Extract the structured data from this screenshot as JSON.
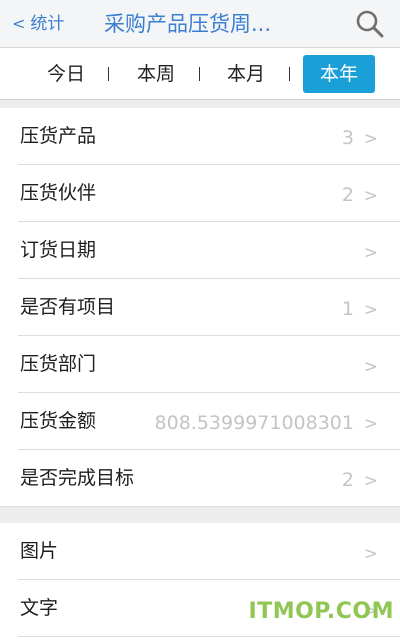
{
  "navbar": {
    "back_chevron": "<",
    "back_label": "统计",
    "title": "采购产品压货周...",
    "search_icon": "search-icon"
  },
  "tabs": [
    {
      "label": "今日",
      "active": false
    },
    {
      "label": "本周",
      "active": false
    },
    {
      "label": "本月",
      "active": false
    },
    {
      "label": "本年",
      "active": true
    }
  ],
  "list_group_1": [
    {
      "label": "压货产品",
      "value": "3",
      "chevron": ">"
    },
    {
      "label": "压货伙伴",
      "value": "2",
      "chevron": ">"
    },
    {
      "label": "订货日期",
      "value": "",
      "chevron": ">"
    },
    {
      "label": "是否有项目",
      "value": "1",
      "chevron": ">"
    },
    {
      "label": "压货部门",
      "value": "",
      "chevron": ">"
    },
    {
      "label": "压货金额",
      "value": "808.5399971008301",
      "chevron": ">"
    },
    {
      "label": "是否完成目标",
      "value": "2",
      "chevron": ">"
    }
  ],
  "list_group_2": [
    {
      "label": "图片",
      "value": "",
      "chevron": ">"
    },
    {
      "label": "文字",
      "value": "",
      "chevron": ">"
    }
  ],
  "watermark": "ITMOP.COM",
  "colors": {
    "accent": "#1a9fd6",
    "nav_text": "#3b7fd0",
    "muted": "#c4c4c4",
    "watermark": "#8bc34a"
  }
}
